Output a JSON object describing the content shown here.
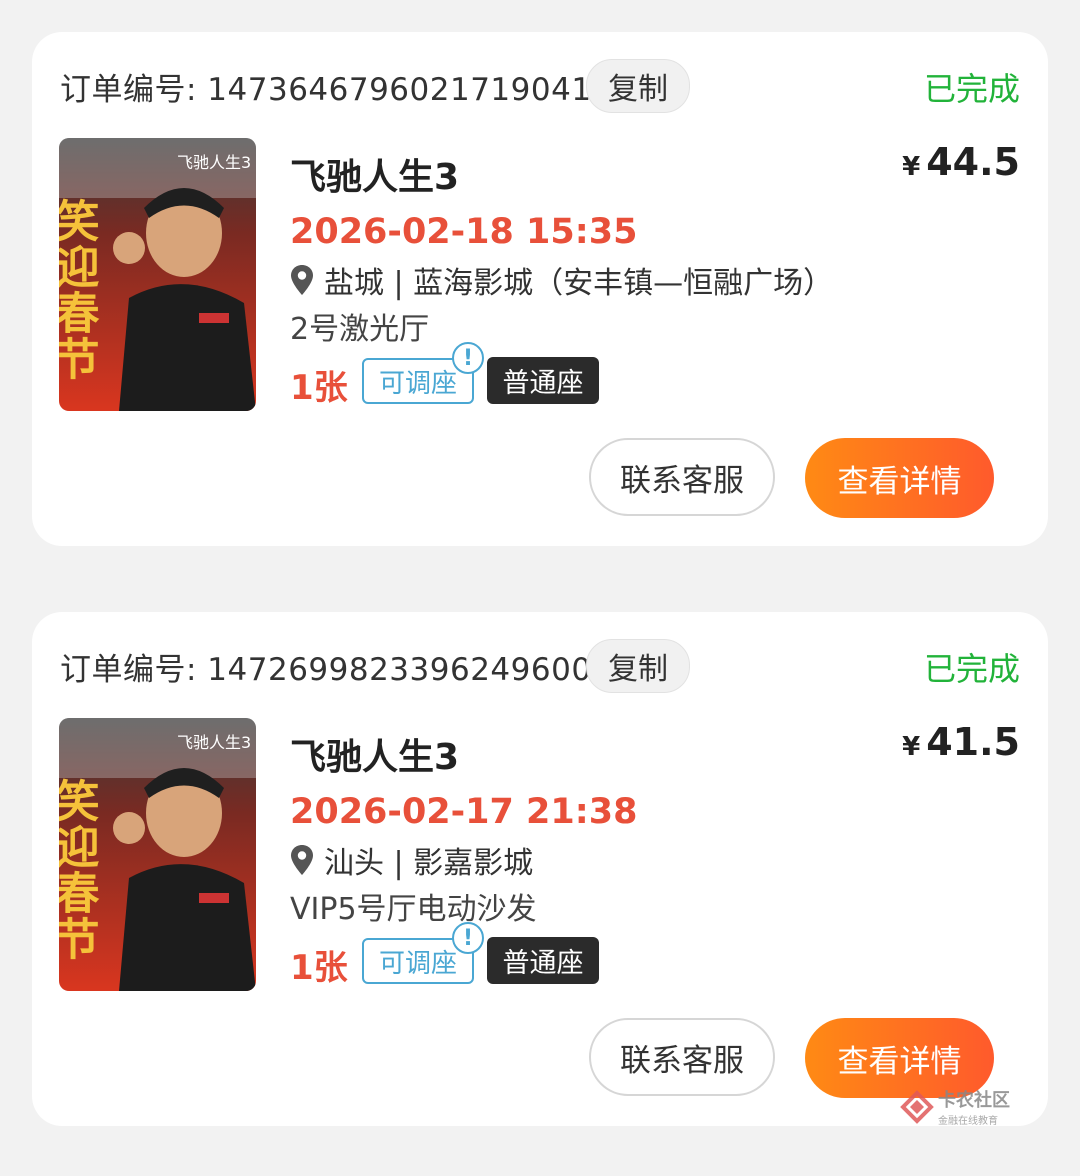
{
  "orders": [
    {
      "order_label": "订单编号: 1473646796021719041",
      "copy_label": "复制",
      "status": "已完成",
      "poster_text": "笑迎春节",
      "poster_logo": "飞驰人生3",
      "title": "飞驰人生3",
      "currency": "¥",
      "price": "44.5",
      "show_time": "2026-02-18 15:35",
      "location": "盐城 | 蓝海影城（安丰镇—恒融广场）",
      "hall": "2号激光厅",
      "ticket_count": "1张",
      "adjust_label": "可调座",
      "alert_mark": "!",
      "seat_type": "普通座",
      "contact_label": "联系客服",
      "detail_label": "查看详情"
    },
    {
      "order_label": "订单编号: 1472699823396249600",
      "copy_label": "复制",
      "status": "已完成",
      "poster_text": "笑迎春节",
      "poster_logo": "飞驰人生3",
      "title": "飞驰人生3",
      "currency": "¥",
      "price": "41.5",
      "show_time": "2026-02-17 21:38",
      "location": "汕头 | 影嘉影城",
      "hall": "VIP5号厅电动沙发",
      "ticket_count": "1张",
      "adjust_label": "可调座",
      "alert_mark": "!",
      "seat_type": "普通座",
      "contact_label": "联系客服",
      "detail_label": "查看详情"
    }
  ],
  "watermark": {
    "main": "卡农社区",
    "sub": "金融在线教育"
  },
  "colors": {
    "status_green": "#22b33a",
    "accent_red": "#e8503a",
    "badge_blue": "#4aa7d3",
    "button_orange": "#ff7a1e"
  },
  "icons": [
    "location-pin-icon",
    "alert-icon",
    "kanong-logo-icon"
  ]
}
